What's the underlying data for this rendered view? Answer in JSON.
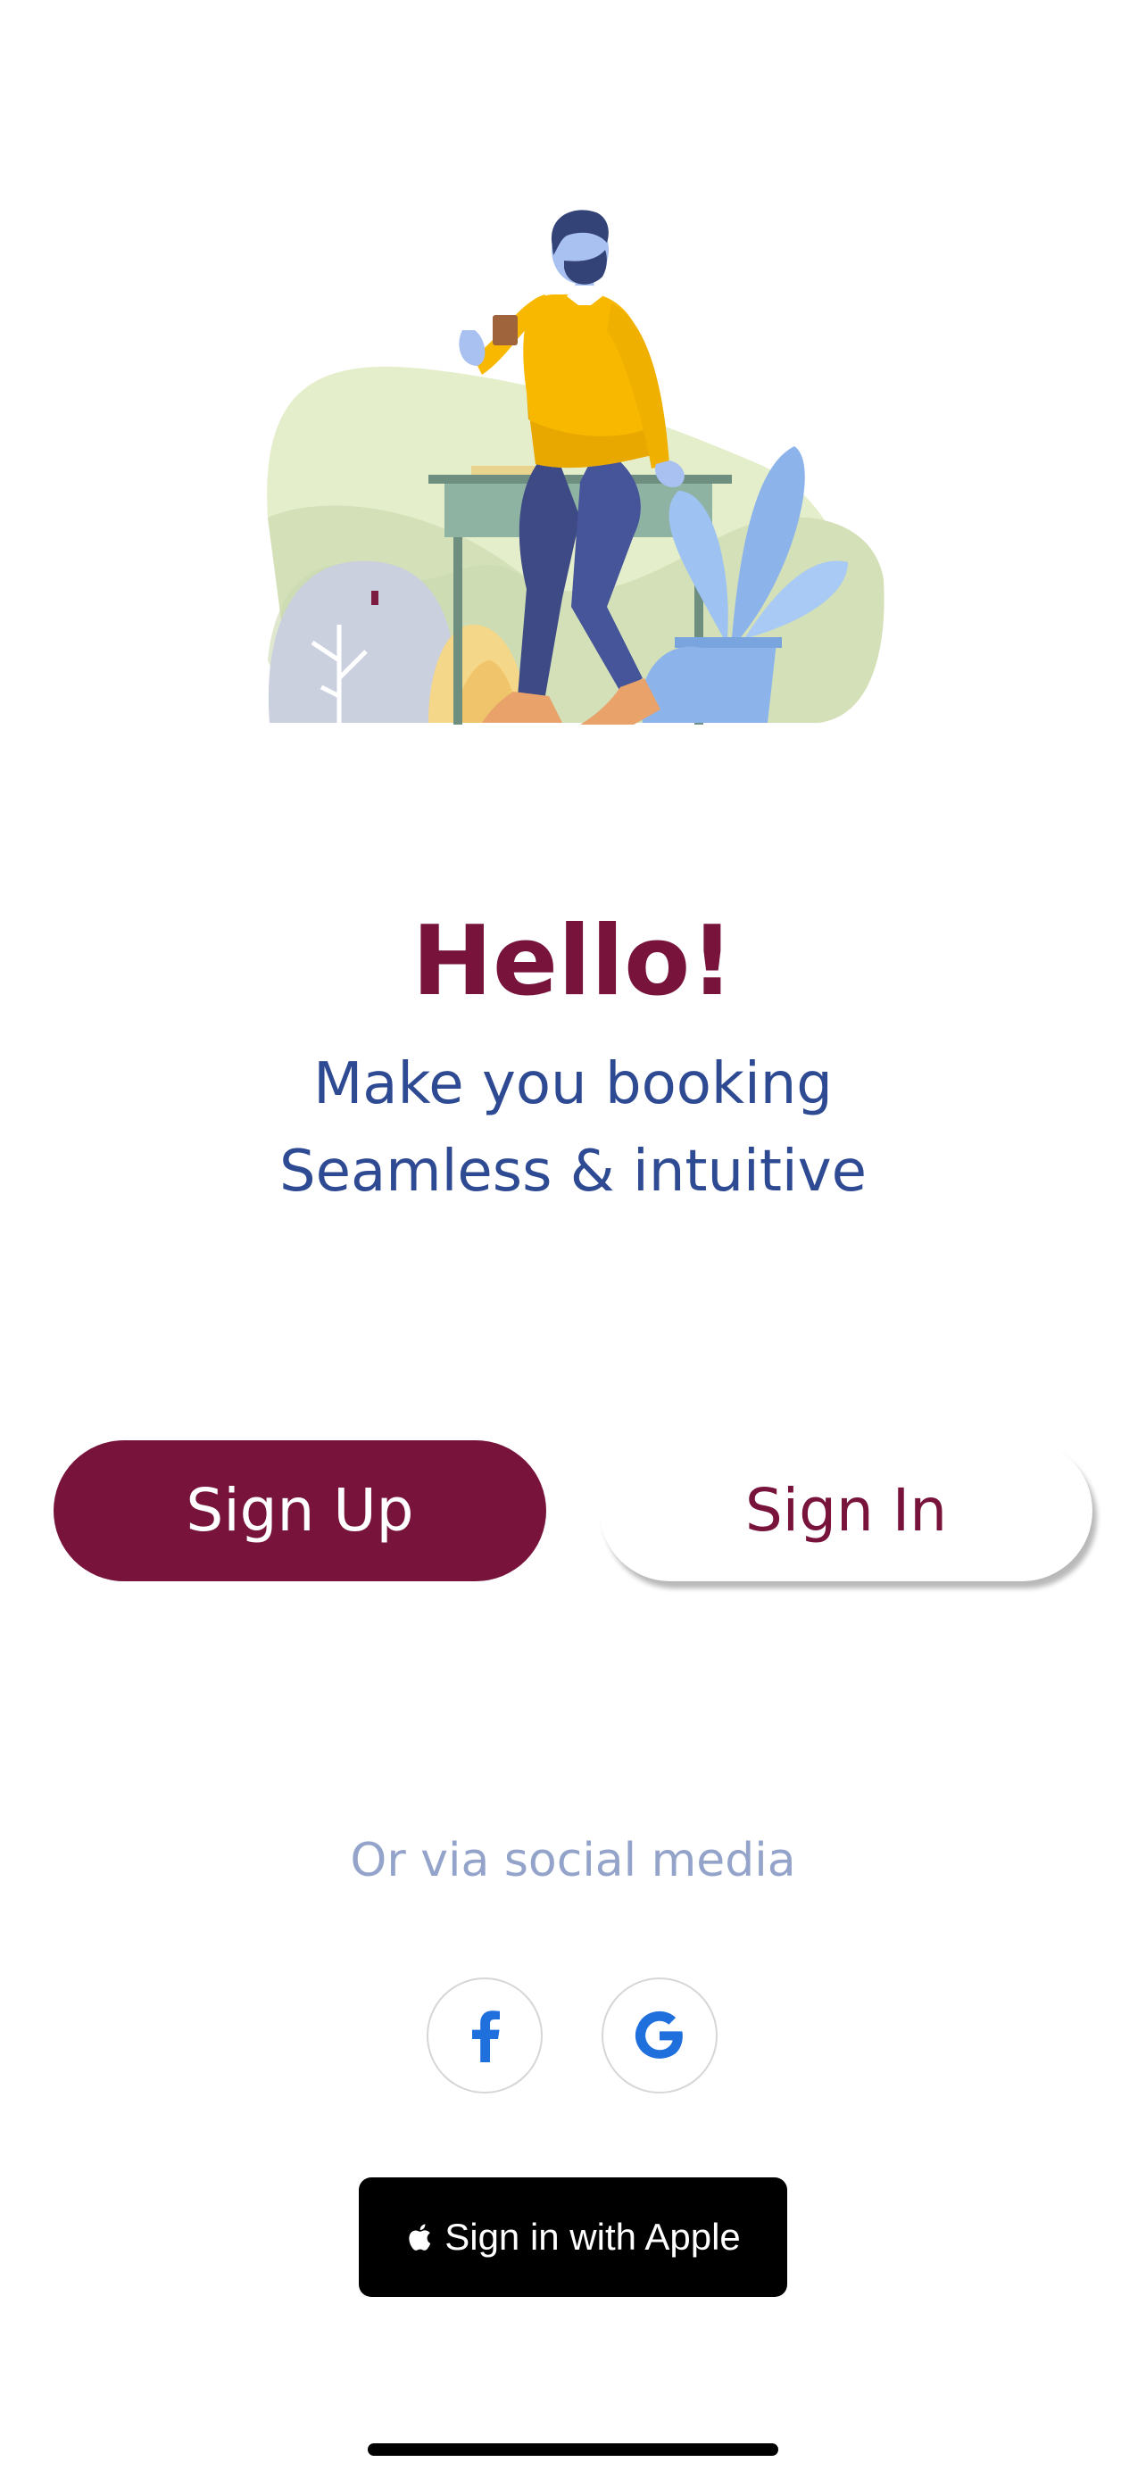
{
  "hero": {
    "title": "Hello!",
    "subtitle_line1": "Make you booking",
    "subtitle_line2": "Seamless & intuitive"
  },
  "auth": {
    "sign_up_label": "Sign Up",
    "sign_in_label": "Sign In"
  },
  "social": {
    "divider_text": "Or via social media",
    "providers": [
      {
        "name": "facebook",
        "icon": "facebook-icon"
      },
      {
        "name": "google",
        "icon": "google-icon"
      }
    ],
    "apple_label": "Sign in with Apple"
  },
  "colors": {
    "brand": "#78133b",
    "subtitle": "#2e4a93",
    "muted": "#93a3c9",
    "social_icon": "#1f6fdc"
  }
}
